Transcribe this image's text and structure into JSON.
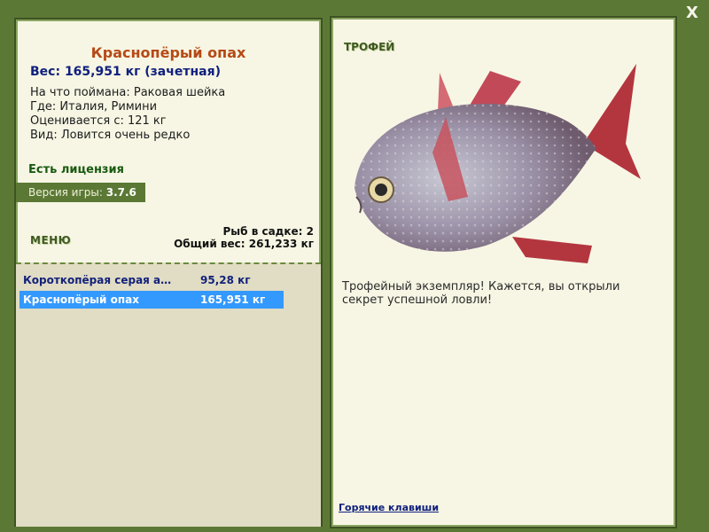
{
  "window": {
    "close_label": "X"
  },
  "fish": {
    "name": "Краснопёрый опах",
    "weight_line": "Вес: 165,951 кг (зачетная)",
    "bait": "На что поймана: Раковая шейка",
    "location": "Где: Италия, Римини",
    "rated_from": "Оценивается с: 121 кг",
    "rarity": "Вид: Ловится очень редко"
  },
  "license": "Есть лицензия",
  "version": {
    "label": "Версия игры:",
    "value": "3.7.6"
  },
  "menu_label": "МЕНЮ",
  "stats": {
    "fish_count": "Рыб в садке: 2",
    "total_weight": "Общий вес: 261,233 кг"
  },
  "catch_list": [
    {
      "name": "Коротко­пёрая серая а…",
      "weight": "95,28 кг",
      "selected": false
    },
    {
      "name": "Краснопёрый опах",
      "weight": "165,951 кг",
      "selected": true
    }
  ],
  "trophy": {
    "label": "ТРОФЕЙ",
    "text": "Трофейный экземпляр! Кажется, вы открыли секрет успешной ловли!"
  },
  "hotkeys_label": "Горячие клавиши",
  "colors": {
    "frame_green": "#5b7935",
    "panel_bg": "#f7f6e4",
    "title_orange": "#b64a16",
    "weight_blue": "#10207d",
    "selected_row": "#3399ff"
  }
}
